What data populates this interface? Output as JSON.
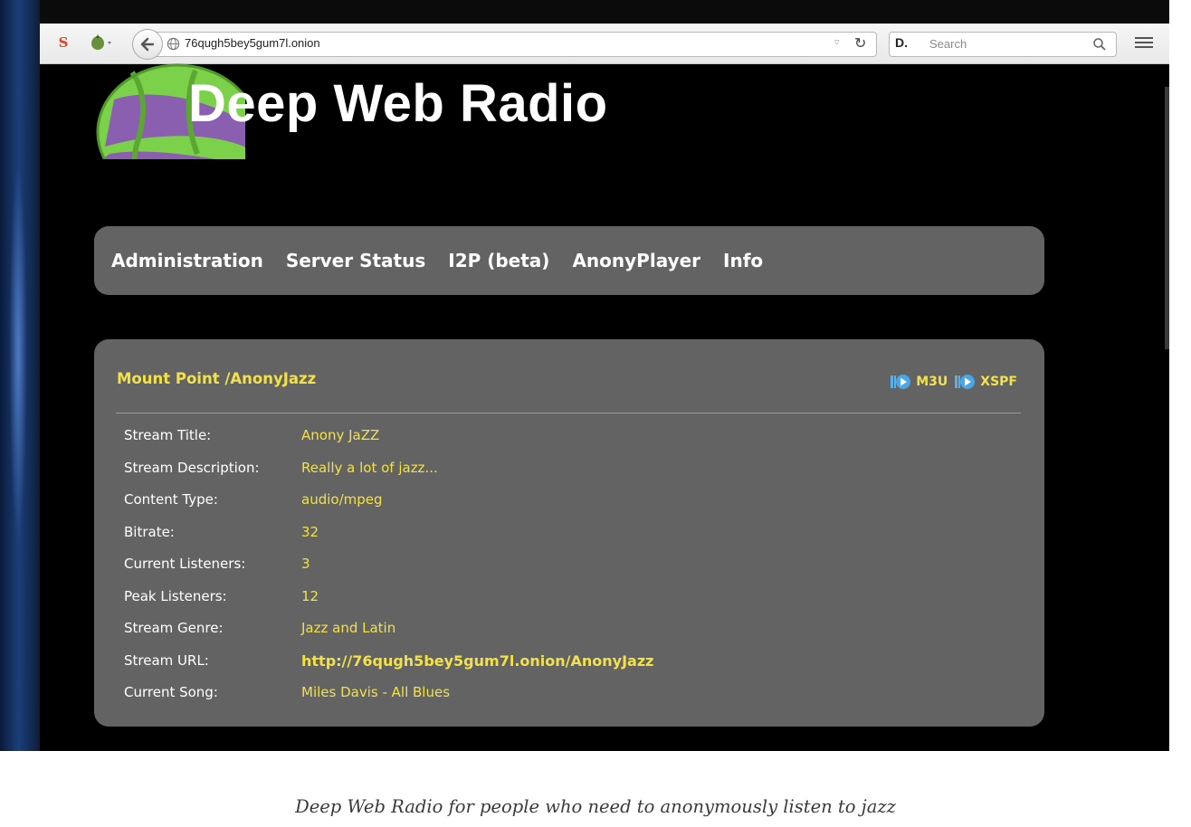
{
  "browser": {
    "url": "76qugh5bey5gum7l.onion",
    "search_engine_label": "D.",
    "search_placeholder": "Search"
  },
  "site": {
    "title": "Deep Web Radio"
  },
  "nav": {
    "items": [
      "Administration",
      "Server Status",
      "I2P (beta)",
      "AnonyPlayer",
      "Info"
    ]
  },
  "mount": {
    "title": "Mount Point /AnonyJazz",
    "playlists": [
      "M3U",
      "XSPF"
    ],
    "rows": [
      {
        "label": "Stream Title:",
        "value": "Anony JaZZ"
      },
      {
        "label": "Stream Description:",
        "value": "Really a lot of jazz..."
      },
      {
        "label": "Content Type:",
        "value": "audio/mpeg"
      },
      {
        "label": "Bitrate:",
        "value": "32"
      },
      {
        "label": "Current Listeners:",
        "value": "3"
      },
      {
        "label": "Peak Listeners:",
        "value": "12"
      },
      {
        "label": "Stream Genre:",
        "value": "Jazz and Latin"
      },
      {
        "label": "Stream URL:",
        "value": "http://76qugh5bey5gum7l.onion/AnonyJazz"
      },
      {
        "label": "Current Song:",
        "value": "Miles Davis - All Blues"
      }
    ]
  },
  "caption": "Deep Web Radio for people who need to anonymously listen to jazz",
  "colors": {
    "accent_yellow": "#f2e14a",
    "panel_gray": "#636363",
    "page_bg": "#000000",
    "logo_green": "#7bd24a",
    "logo_purple": "#8a5fb0"
  },
  "icons": [
    "stumbleupon-icon",
    "extension-icon",
    "back-arrow-icon",
    "globe-icon",
    "reload-icon",
    "search-icon",
    "hamburger-menu-icon",
    "playlist-icon"
  ]
}
